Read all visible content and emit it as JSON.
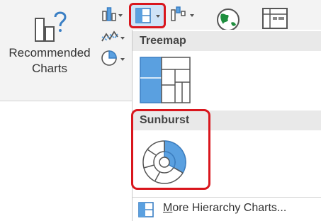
{
  "ribbon": {
    "recommended_charts": {
      "line1": "Recommended",
      "line2": "Charts"
    }
  },
  "dropdown": {
    "treemap_header": "Treemap",
    "sunburst_header": "Sunburst",
    "more_link": {
      "underlined": "M",
      "rest": "ore Hierarchy Charts..."
    }
  },
  "colors": {
    "accent_blue": "#5aa0e0",
    "highlight_red": "#d9161d",
    "icon_green": "#1e8e3e"
  }
}
